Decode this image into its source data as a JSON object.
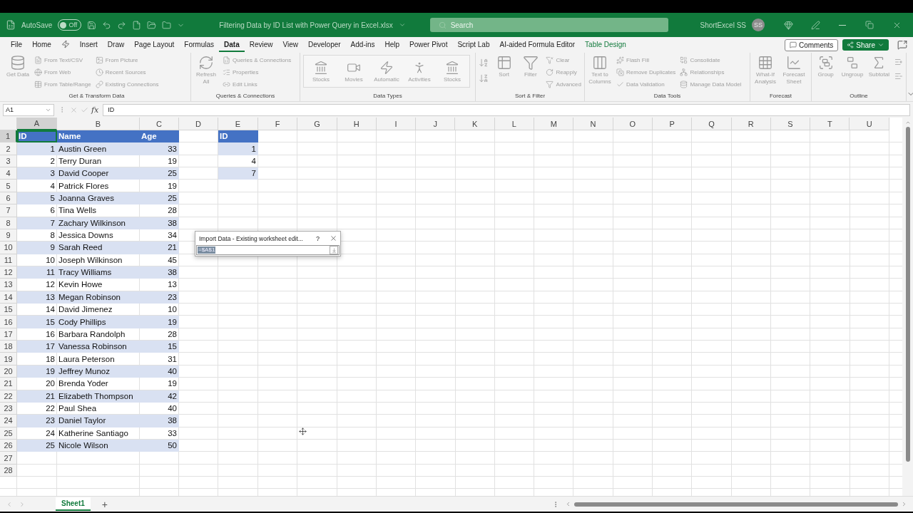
{
  "title_bar": {
    "autosave_label": "AutoSave",
    "autosave_state": "Off",
    "autosave_on": false,
    "filename": "Filtering Data by ID List with Power Query in Excel.xlsx",
    "search_placeholder": "Search",
    "user_name": "ShortExcel SS",
    "avatar_initials": "SS"
  },
  "menu_tabs": [
    {
      "label": "File",
      "selected": false,
      "kind": "plain"
    },
    {
      "label": "Home",
      "selected": false,
      "kind": "plain"
    },
    {
      "selected": false,
      "kind": "icon"
    },
    {
      "label": "Insert",
      "selected": false,
      "kind": "plain"
    },
    {
      "label": "Draw",
      "selected": false,
      "kind": "plain"
    },
    {
      "label": "Page Layout",
      "selected": false,
      "kind": "plain"
    },
    {
      "label": "Formulas",
      "selected": false,
      "kind": "plain"
    },
    {
      "label": "Data",
      "selected": true,
      "kind": "plain"
    },
    {
      "label": "Review",
      "selected": false,
      "kind": "plain"
    },
    {
      "label": "View",
      "selected": false,
      "kind": "plain"
    },
    {
      "label": "Developer",
      "selected": false,
      "kind": "plain"
    },
    {
      "label": "Add-ins",
      "selected": false,
      "kind": "plain"
    },
    {
      "label": "Help",
      "selected": false,
      "kind": "plain"
    },
    {
      "label": "Power Pivot",
      "selected": false,
      "kind": "plain"
    },
    {
      "label": "Script Lab",
      "selected": false,
      "kind": "plain"
    },
    {
      "label": "AI-aided Formula Editor",
      "selected": false,
      "kind": "plain"
    },
    {
      "label": "Table Design",
      "selected": false,
      "kind": "contextual"
    }
  ],
  "comments_button": "Comments",
  "share_button": "Share",
  "ribbon_groups": [
    {
      "label": "Get & Transform Data",
      "columns": [
        {
          "kind": "large",
          "label": "Get Data"
        },
        {
          "kind": "stack",
          "items": [
            "From Text/CSV",
            "From Web",
            "From Table/Range"
          ]
        },
        {
          "kind": "stack",
          "items": [
            "From Picture",
            "Recent Sources",
            "Existing Connections"
          ]
        }
      ]
    },
    {
      "label": "Queries & Connections",
      "columns": [
        {
          "kind": "large",
          "label": "Refresh All"
        },
        {
          "kind": "stack",
          "items": [
            "Queries & Connections",
            "Properties",
            "Edit Links"
          ]
        }
      ]
    },
    {
      "label": "Data Types",
      "columns": [
        {
          "kind": "gallery",
          "items": [
            "Stocks",
            "Movies",
            "Automatic",
            "Activities",
            "Stocks"
          ]
        }
      ]
    },
    {
      "label": "Sort & Filter",
      "columns": [
        {
          "kind": "sortpair"
        },
        {
          "kind": "large",
          "label": "Sort"
        },
        {
          "kind": "large",
          "label": "Filter"
        },
        {
          "kind": "stack",
          "items": [
            "Clear",
            "Reapply",
            "Advanced"
          ]
        }
      ]
    },
    {
      "label": "Data Tools",
      "columns": [
        {
          "kind": "large",
          "label": "Text to Columns"
        },
        {
          "kind": "stack",
          "items": [
            "Flash Fill",
            "Remove Duplicates",
            "Data Validation"
          ]
        },
        {
          "kind": "stack",
          "items": [
            "Consolidate",
            "Relationships",
            "Manage Data Model"
          ]
        }
      ]
    },
    {
      "label": "Forecast",
      "columns": [
        {
          "kind": "large",
          "label": "What-If Analysis"
        },
        {
          "kind": "large",
          "label": "Forecast Sheet"
        }
      ]
    },
    {
      "label": "Outline",
      "columns": [
        {
          "kind": "large",
          "label": "Group"
        },
        {
          "kind": "large",
          "label": "Ungroup"
        },
        {
          "kind": "large",
          "label": "Subtotal"
        },
        {
          "kind": "smallicons"
        }
      ]
    }
  ],
  "formula_bar": {
    "name_box": "A1",
    "fx": "fx",
    "formula": "ID"
  },
  "sheet": {
    "columns": [
      {
        "label": "A",
        "selected": true
      },
      {
        "label": "B",
        "selected": false
      },
      {
        "label": "C",
        "selected": false
      },
      {
        "label": "D",
        "selected": false
      },
      {
        "label": "E",
        "selected": false
      },
      {
        "label": "F",
        "selected": false
      },
      {
        "label": "G",
        "selected": false
      },
      {
        "label": "H",
        "selected": false
      },
      {
        "label": "I",
        "selected": false
      },
      {
        "label": "J",
        "selected": false
      },
      {
        "label": "K",
        "selected": false
      },
      {
        "label": "L",
        "selected": false
      },
      {
        "label": "M",
        "selected": false
      },
      {
        "label": "N",
        "selected": false
      },
      {
        "label": "O",
        "selected": false
      },
      {
        "label": "P",
        "selected": false
      },
      {
        "label": "Q",
        "selected": false
      },
      {
        "label": "R",
        "selected": false
      },
      {
        "label": "S",
        "selected": false
      },
      {
        "label": "T",
        "selected": false
      },
      {
        "label": "U",
        "selected": false
      }
    ],
    "rows": [
      {
        "label": "1",
        "selected": true
      },
      {
        "label": "2",
        "selected": false
      },
      {
        "label": "3",
        "selected": false
      },
      {
        "label": "4",
        "selected": false
      },
      {
        "label": "5",
        "selected": false
      },
      {
        "label": "6",
        "selected": false
      },
      {
        "label": "7",
        "selected": false
      },
      {
        "label": "8",
        "selected": false
      },
      {
        "label": "9",
        "selected": false
      },
      {
        "label": "10",
        "selected": false
      },
      {
        "label": "11",
        "selected": false
      },
      {
        "label": "12",
        "selected": false
      },
      {
        "label": "13",
        "selected": false
      },
      {
        "label": "14",
        "selected": false
      },
      {
        "label": "15",
        "selected": false
      },
      {
        "label": "16",
        "selected": false
      },
      {
        "label": "17",
        "selected": false
      },
      {
        "label": "18",
        "selected": false
      },
      {
        "label": "19",
        "selected": false
      },
      {
        "label": "20",
        "selected": false
      },
      {
        "label": "21",
        "selected": false
      },
      {
        "label": "22",
        "selected": false
      },
      {
        "label": "23",
        "selected": false
      },
      {
        "label": "24",
        "selected": false
      },
      {
        "label": "25",
        "selected": false
      },
      {
        "label": "26",
        "selected": false
      },
      {
        "label": "27",
        "selected": false
      },
      {
        "label": "28",
        "selected": false
      }
    ],
    "people_table": {
      "headers": [
        {
          "label": "ID",
          "kind": "number"
        },
        {
          "label": "Name",
          "kind": "text"
        },
        {
          "label": "Age",
          "kind": "number"
        }
      ],
      "rows": [
        [
          "1",
          "Austin Green",
          "33"
        ],
        [
          "2",
          "Terry Duran",
          "19"
        ],
        [
          "3",
          "David Cooper",
          "25"
        ],
        [
          "4",
          "Patrick Flores",
          "19"
        ],
        [
          "5",
          "Joanna Graves",
          "25"
        ],
        [
          "6",
          "Tina Wells",
          "28"
        ],
        [
          "7",
          "Zachary Wilkinson",
          "38"
        ],
        [
          "8",
          "Jessica Downs",
          "34"
        ],
        [
          "9",
          "Sarah Reed",
          "21"
        ],
        [
          "10",
          "Joseph Wilkinson",
          "45"
        ],
        [
          "11",
          "Tracy Williams",
          "38"
        ],
        [
          "12",
          "Kevin Howe",
          "13"
        ],
        [
          "13",
          "Megan Robinson",
          "23"
        ],
        [
          "14",
          "David Jimenez",
          "10"
        ],
        [
          "15",
          "Cody Phillips",
          "19"
        ],
        [
          "16",
          "Barbara Randolph",
          "28"
        ],
        [
          "17",
          "Vanessa Robinson",
          "15"
        ],
        [
          "18",
          "Laura Peterson",
          "31"
        ],
        [
          "19",
          "Jeffrey Munoz",
          "40"
        ],
        [
          "20",
          "Brenda Yoder",
          "19"
        ],
        [
          "21",
          "Elizabeth Thompson",
          "42"
        ],
        [
          "22",
          "Paul Shea",
          "40"
        ],
        [
          "23",
          "Daniel Taylor",
          "38"
        ],
        [
          "24",
          "Katherine Santiago",
          "33"
        ],
        [
          "25",
          "Nicole Wilson",
          "50"
        ]
      ]
    },
    "id_table": {
      "headers": [
        {
          "label": "ID",
          "kind": "number"
        }
      ],
      "rows": [
        [
          "1"
        ],
        [
          "4"
        ],
        [
          "7"
        ]
      ]
    }
  },
  "dialog": {
    "title": "Import Data - Existing worksheet edit...",
    "help": "?",
    "value": "=$A$1"
  },
  "sheet_tabs": [
    {
      "label": "Sheet1",
      "selected": true
    }
  ],
  "add_sheet": "+"
}
